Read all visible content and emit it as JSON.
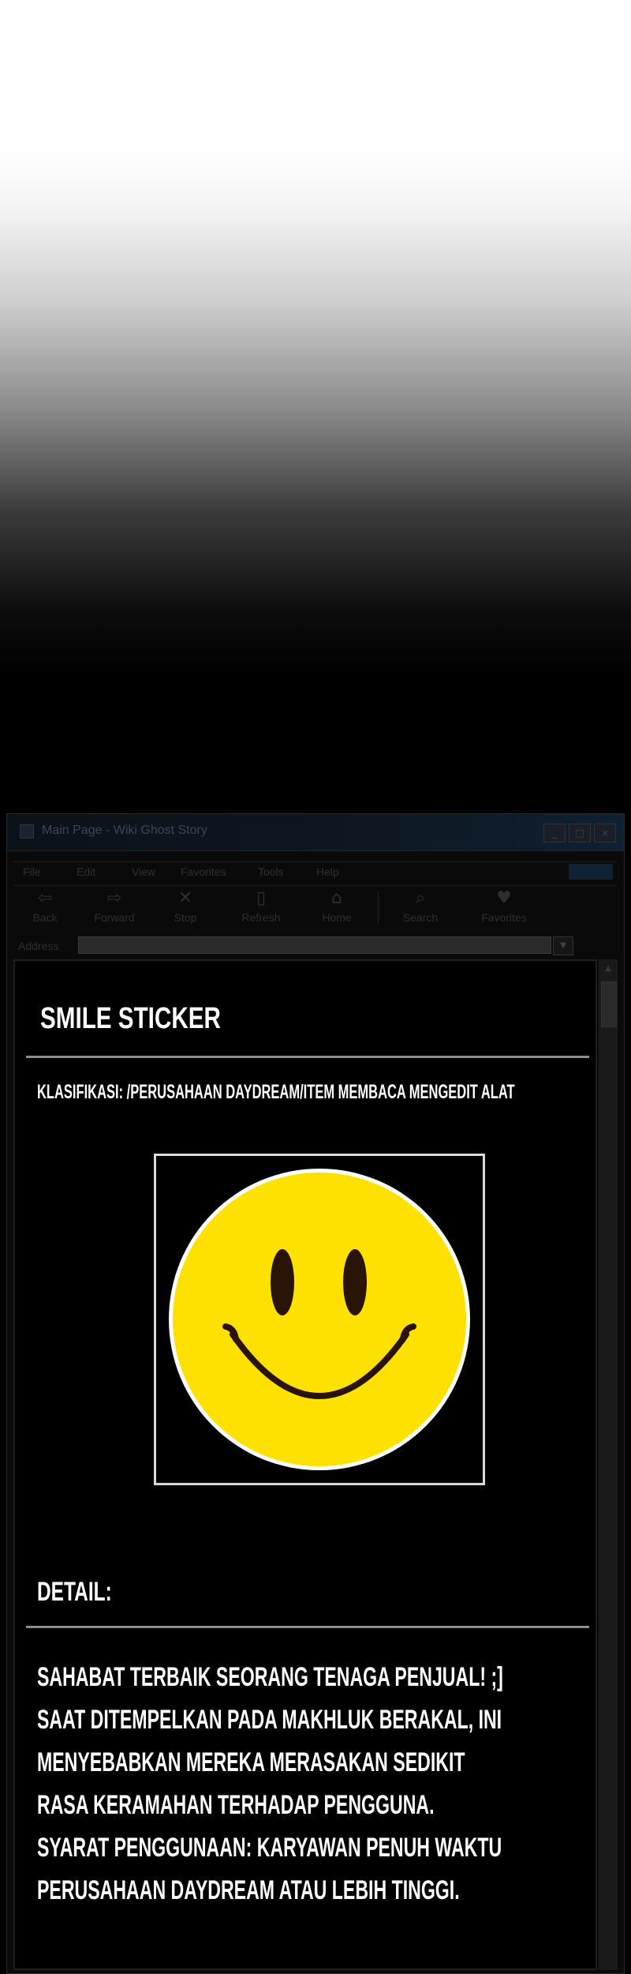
{
  "window": {
    "title": "Main Page - Wiki Ghost Story",
    "controls": [
      "_",
      "□",
      "×"
    ]
  },
  "menu": [
    "File",
    "Edit",
    "View",
    "Favorites",
    "Tools",
    "Help"
  ],
  "toolbar": [
    {
      "label": "Back",
      "icon": "back-arrow-icon"
    },
    {
      "label": "Forward",
      "icon": "forward-arrow-icon"
    },
    {
      "label": "Stop",
      "icon": "stop-icon"
    },
    {
      "label": "Refresh",
      "icon": "refresh-icon"
    },
    {
      "label": "Home",
      "icon": "home-icon"
    },
    {
      "label": "Search",
      "icon": "search-icon"
    },
    {
      "label": "Favorites",
      "icon": "heart-icon"
    }
  ],
  "address": {
    "label": "Address",
    "value": ""
  },
  "page": {
    "title": "SMILE STICKER",
    "classification": "KLASIFIKASI: /PERUSAHAAN DAYDREAM/ITEM MEMBACA MENGEDIT ALAT",
    "image_subject": "smiley-face-sticker",
    "detail_heading": "DETAIL:",
    "description_lines": [
      "SAHABAT TERBAIK SEORANG TENAGA PENJUAL! ;]",
      "SAAT DITEMPELKAN PADA MAKHLUK BERAKAL, INI",
      "MENYEBABKAN MEREKA MERASAKAN SEDIKIT",
      "RASA KERAMAHAN TERHADAP PENGGUNA.",
      "SYARAT PENGGUNAAN: KARYAWAN PENUH WAKTU",
      "PERUSAHAAN DAYDREAM ATAU LEBIH TINGGI."
    ]
  },
  "colors": {
    "smiley_yellow": "#ffe100",
    "smiley_features": "#2a1408",
    "background": "#000000",
    "text": "#ffffff"
  }
}
